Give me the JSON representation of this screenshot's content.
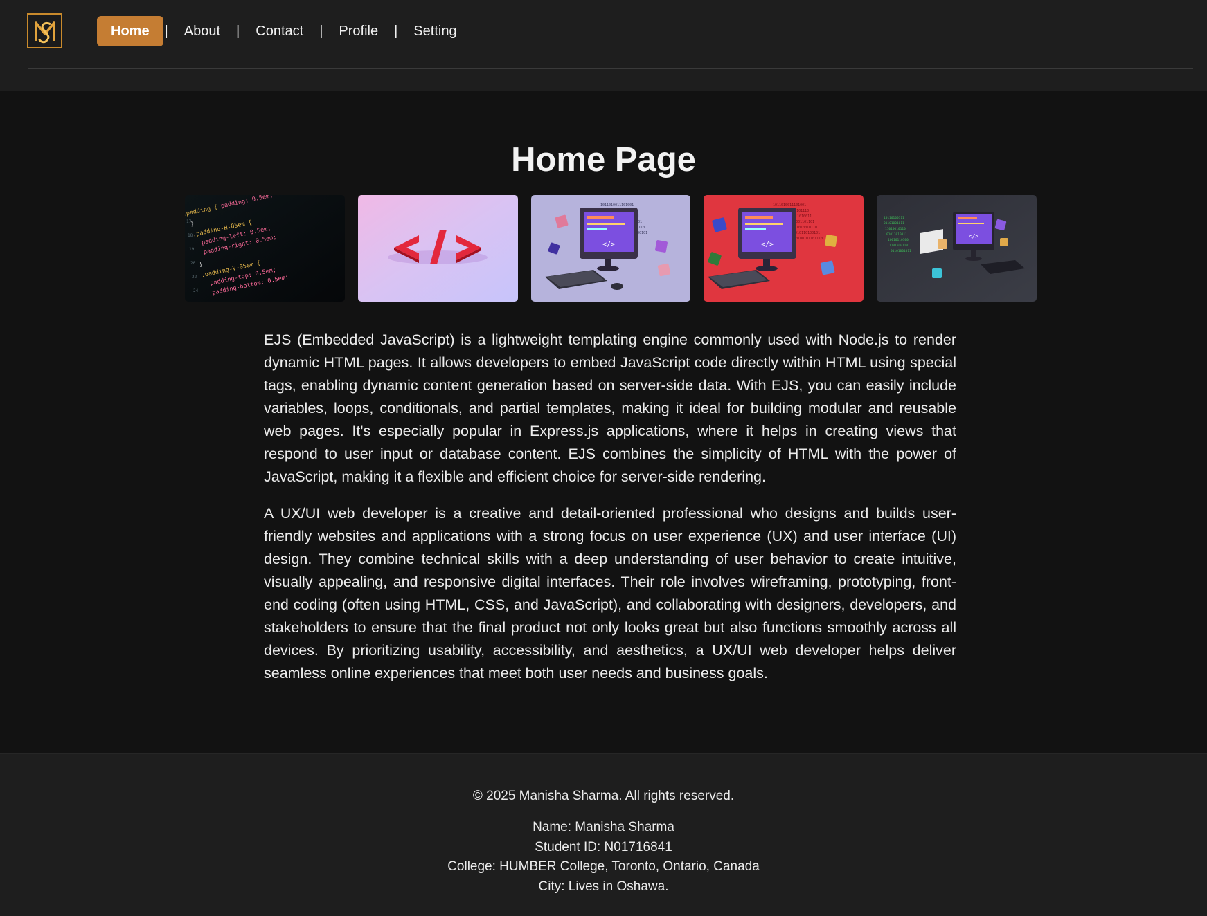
{
  "header": {
    "logo_alt": "MS logo",
    "nav": [
      {
        "label": "Home",
        "active": true
      },
      {
        "label": "About",
        "active": false
      },
      {
        "label": "Contact",
        "active": false
      },
      {
        "label": "Profile",
        "active": false
      },
      {
        "label": "Setting",
        "active": false
      }
    ],
    "separator": "|"
  },
  "main": {
    "title": "Home Page",
    "images": [
      {
        "name": "code-snippet-image"
      },
      {
        "name": "code-brackets-image"
      },
      {
        "name": "computer-purple-image"
      },
      {
        "name": "computer-red-image"
      },
      {
        "name": "computer-dark-image"
      }
    ],
    "paragraphs": [
      "EJS (Embedded JavaScript) is a lightweight templating engine commonly used with Node.js to render dynamic HTML pages. It allows developers to embed JavaScript code directly within HTML using special tags, enabling dynamic content generation based on server-side data. With EJS, you can easily include variables, loops, conditionals, and partial templates, making it ideal for building modular and reusable web pages. It's especially popular in Express.js applications, where it helps in creating views that respond to user input or database content. EJS combines the simplicity of HTML with the power of JavaScript, making it a flexible and efficient choice for server-side rendering.",
      "A UX/UI web developer is a creative and detail-oriented professional who designs and builds user-friendly websites and applications with a strong focus on user experience (UX) and user interface (UI) design. They combine technical skills with a deep understanding of user behavior to create intuitive, visually appealing, and responsive digital interfaces. Their role involves wireframing, prototyping, front-end coding (often using HTML, CSS, and JavaScript), and collaborating with designers, developers, and stakeholders to ensure that the final product not only looks great but also functions smoothly across all devices. By prioritizing usability, accessibility, and aesthetics, a UX/UI web developer helps deliver seamless online experiences that meet both user needs and business goals."
    ]
  },
  "footer": {
    "copyright": "© 2025 Manisha Sharma. All rights reserved.",
    "name": "Name: Manisha Sharma",
    "student_id": "Student ID: N01716841",
    "college": "College: HUMBER College, Toronto, Ontario, Canada",
    "city": "City: Lives in Oshawa."
  },
  "colors": {
    "accent": "#c57d33",
    "background": "#121212",
    "header_bg": "#1e1e1e"
  }
}
